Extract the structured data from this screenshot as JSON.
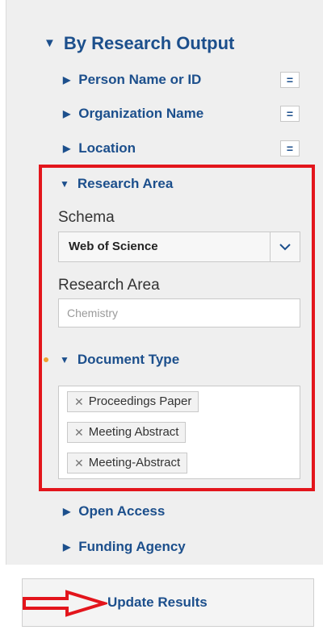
{
  "by_research_output": {
    "title": "By Research Output",
    "items": [
      {
        "label": "Person Name or ID",
        "button": "="
      },
      {
        "label": "Organization Name",
        "button": "="
      },
      {
        "label": "Location",
        "button": "="
      }
    ]
  },
  "research_area": {
    "title": "Research Area",
    "schema_label": "Schema",
    "schema_value": "Web of Science",
    "field_label": "Research Area",
    "field_placeholder": "Chemistry"
  },
  "document_type": {
    "title": "Document Type",
    "tags": [
      "Proceedings Paper",
      "Meeting Abstract",
      "Meeting-Abstract"
    ]
  },
  "more_filters": {
    "open_access": "Open Access",
    "funding_agency": "Funding Agency"
  },
  "update_button": "Update Results",
  "colors": {
    "accent": "#1c4f8c",
    "highlight": "#e3151c",
    "panel": "#efefef"
  }
}
